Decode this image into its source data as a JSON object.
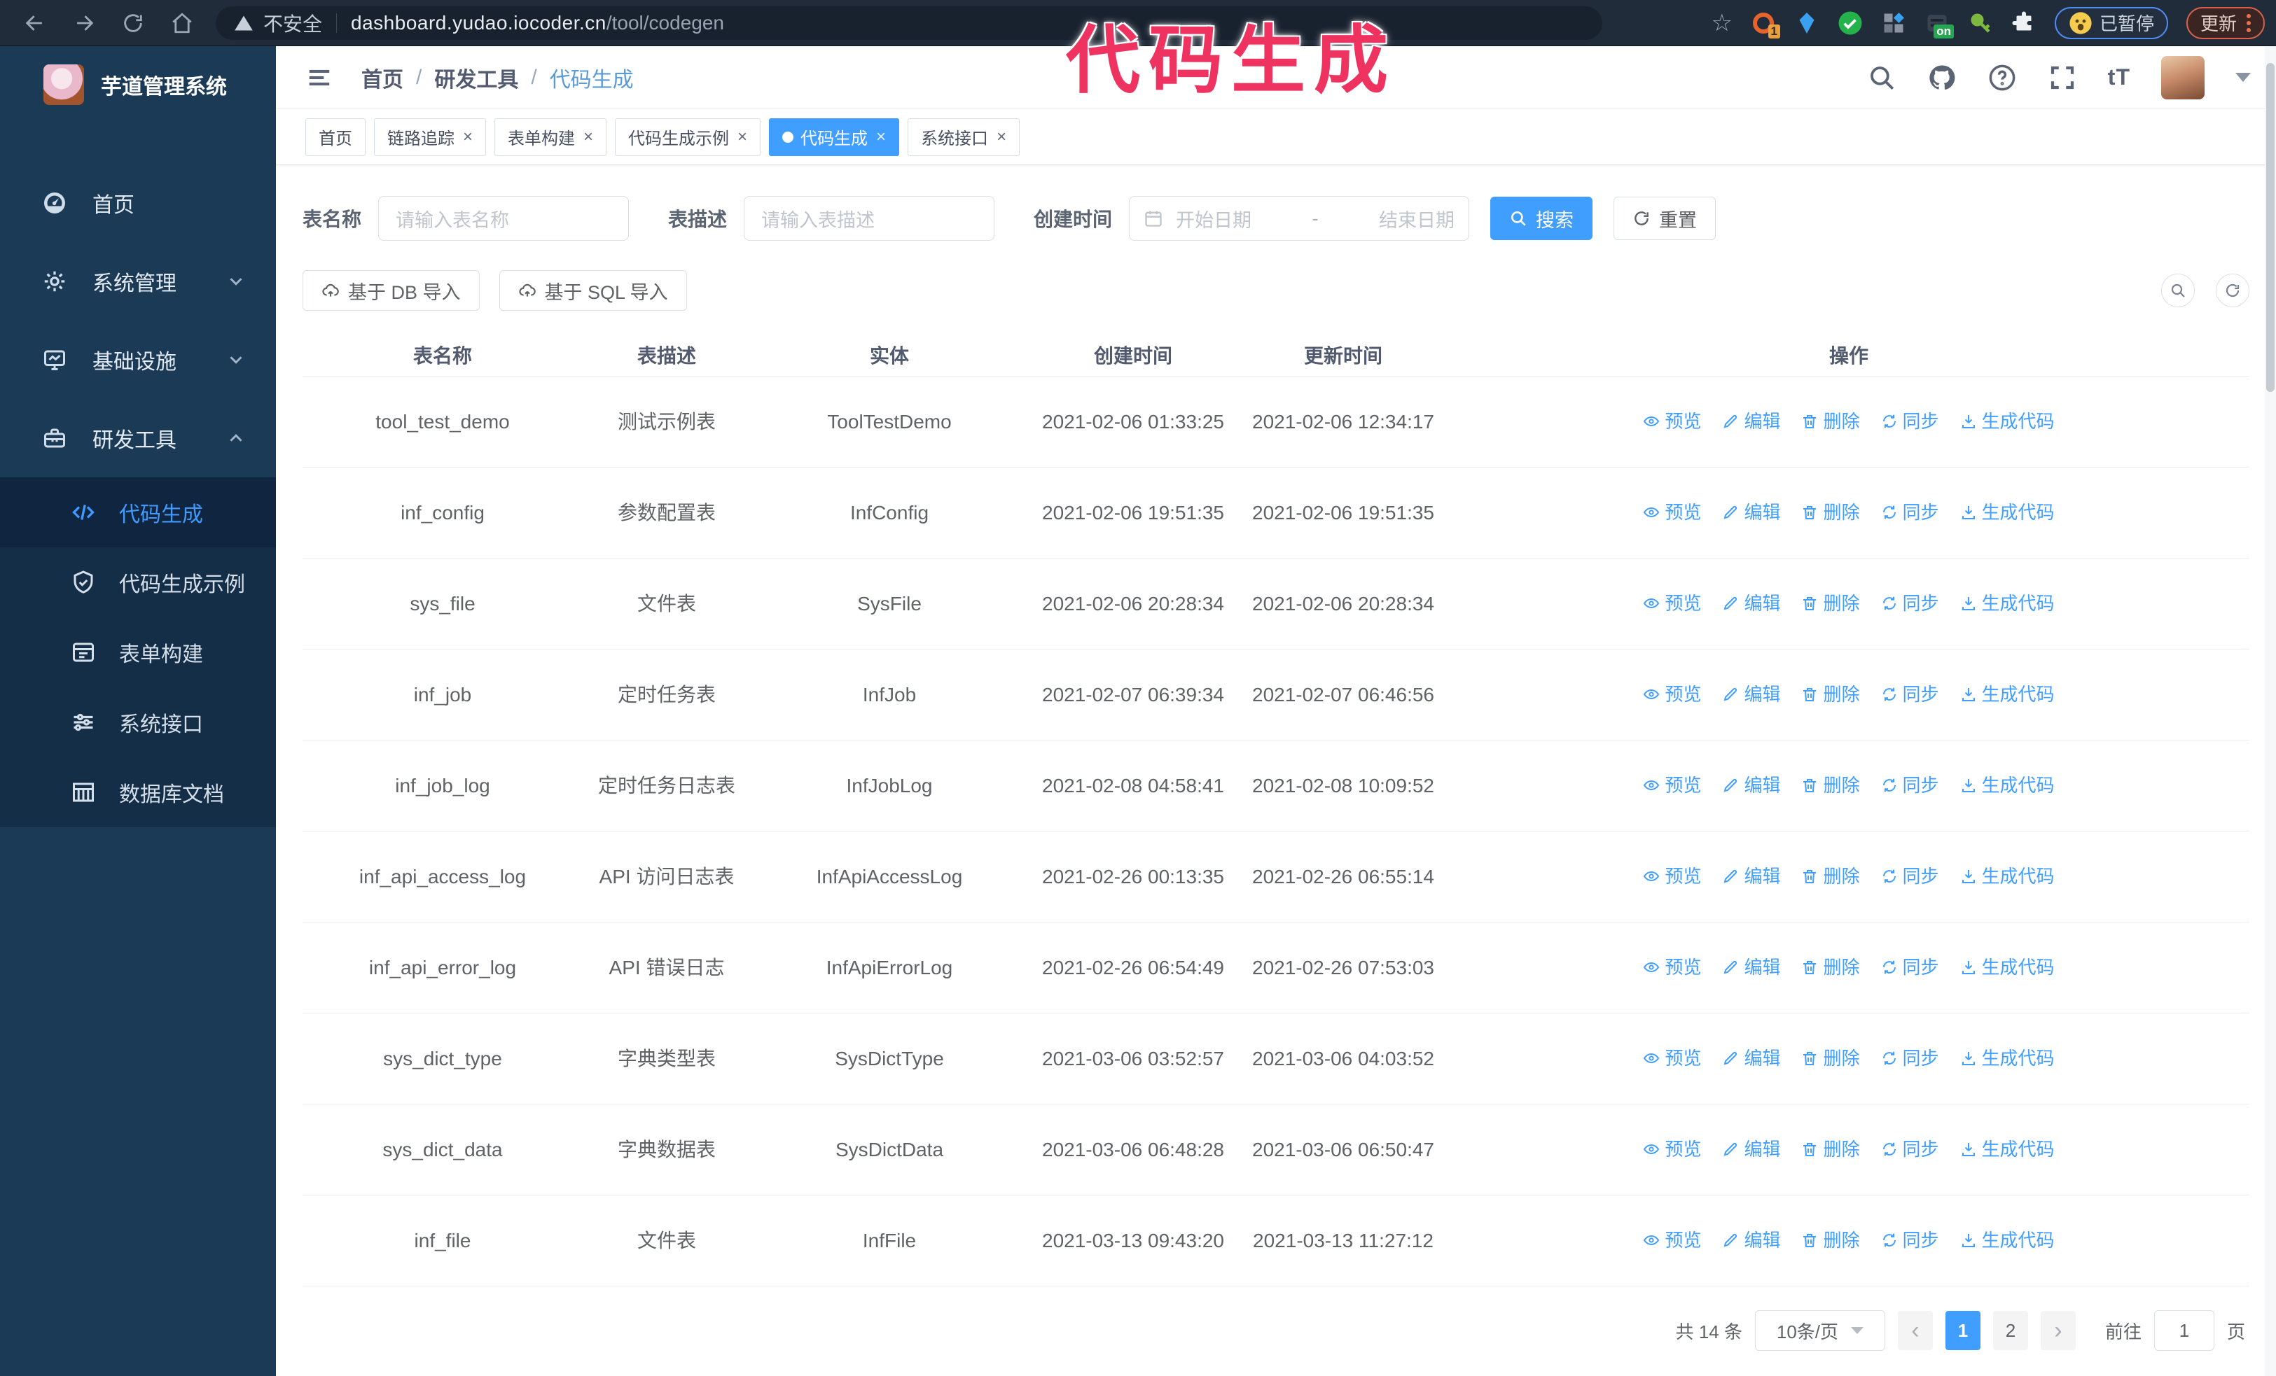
{
  "browser": {
    "security_label": "不安全",
    "url_host": "dashboard.yudao.iocoder.cn",
    "url_path": "/tool/codegen",
    "extension_badge_count": "1",
    "extension_badge_on": "on",
    "paused_badge": "已暂停",
    "update_button": "更新"
  },
  "annotation": {
    "text": "代码生成",
    "color": "#ef3360"
  },
  "sidebar": {
    "logo_title": "芋道管理系统",
    "items": [
      {
        "label": "首页",
        "icon": "dashboard-icon"
      },
      {
        "label": "系统管理",
        "icon": "gear-icon",
        "chevron": "down"
      },
      {
        "label": "基础设施",
        "icon": "monitor-icon",
        "chevron": "down"
      },
      {
        "label": "研发工具",
        "icon": "toolbox-icon",
        "chevron": "up",
        "expanded": true
      }
    ],
    "subitems": [
      {
        "label": "代码生成",
        "icon": "code-icon",
        "active": true
      },
      {
        "label": "代码生成示例",
        "icon": "shield-check-icon",
        "active": false
      },
      {
        "label": "表单构建",
        "icon": "form-icon",
        "active": false
      },
      {
        "label": "系统接口",
        "icon": "sliders-icon",
        "active": false
      },
      {
        "label": "数据库文档",
        "icon": "database-doc-icon",
        "active": false
      }
    ]
  },
  "header": {
    "breadcrumb": [
      "首页",
      "研发工具",
      "代码生成"
    ],
    "breadcrumb_separator": "/"
  },
  "tabs": [
    {
      "label": "首页",
      "closable": false,
      "active": false
    },
    {
      "label": "链路追踪",
      "closable": true,
      "active": false
    },
    {
      "label": "表单构建",
      "closable": true,
      "active": false
    },
    {
      "label": "代码生成示例",
      "closable": true,
      "active": false
    },
    {
      "label": "代码生成",
      "closable": true,
      "active": true
    },
    {
      "label": "系统接口",
      "closable": true,
      "active": false
    }
  ],
  "search_form": {
    "table_name_label": "表名称",
    "table_name_placeholder": "请输入表名称",
    "table_desc_label": "表描述",
    "table_desc_placeholder": "请输入表描述",
    "create_time_label": "创建时间",
    "date_start_placeholder": "开始日期",
    "date_separator": "-",
    "date_end_placeholder": "结束日期",
    "search_button": "搜索",
    "reset_button": "重置"
  },
  "toolbar": {
    "import_db_button": "基于 DB 导入",
    "import_sql_button": "基于 SQL 导入"
  },
  "table": {
    "columns": [
      "表名称",
      "表描述",
      "实体",
      "创建时间",
      "更新时间",
      "操作"
    ],
    "actions": [
      "预览",
      "编辑",
      "删除",
      "同步",
      "生成代码"
    ],
    "rows": [
      {
        "name": "tool_test_demo",
        "desc": "测试示例表",
        "entity": "ToolTestDemo",
        "created": "2021-02-06 01:33:25",
        "updated": "2021-02-06 12:34:17"
      },
      {
        "name": "inf_config",
        "desc": "参数配置表",
        "entity": "InfConfig",
        "created": "2021-02-06 19:51:35",
        "updated": "2021-02-06 19:51:35"
      },
      {
        "name": "sys_file",
        "desc": "文件表",
        "entity": "SysFile",
        "created": "2021-02-06 20:28:34",
        "updated": "2021-02-06 20:28:34"
      },
      {
        "name": "inf_job",
        "desc": "定时任务表",
        "entity": "InfJob",
        "created": "2021-02-07 06:39:34",
        "updated": "2021-02-07 06:46:56"
      },
      {
        "name": "inf_job_log",
        "desc": "定时任务日志表",
        "entity": "InfJobLog",
        "created": "2021-02-08 04:58:41",
        "updated": "2021-02-08 10:09:52"
      },
      {
        "name": "inf_api_access_log",
        "desc": "API 访问日志表",
        "entity": "InfApiAccessLog",
        "created": "2021-02-26 00:13:35",
        "updated": "2021-02-26 06:55:14"
      },
      {
        "name": "inf_api_error_log",
        "desc": "API 错误日志",
        "entity": "InfApiErrorLog",
        "created": "2021-02-26 06:54:49",
        "updated": "2021-02-26 07:53:03"
      },
      {
        "name": "sys_dict_type",
        "desc": "字典类型表",
        "entity": "SysDictType",
        "created": "2021-03-06 03:52:57",
        "updated": "2021-03-06 04:03:52"
      },
      {
        "name": "sys_dict_data",
        "desc": "字典数据表",
        "entity": "SysDictData",
        "created": "2021-03-06 06:48:28",
        "updated": "2021-03-06 06:50:47"
      },
      {
        "name": "inf_file",
        "desc": "文件表",
        "entity": "InfFile",
        "created": "2021-03-13 09:43:20",
        "updated": "2021-03-13 11:27:12"
      }
    ]
  },
  "pagination": {
    "total_text": "共 14 条",
    "page_size": "10条/页",
    "prev_arrow": "‹",
    "next_arrow": "›",
    "pages": [
      "1",
      "2"
    ],
    "active_page": "1",
    "goto_label": "前往",
    "goto_value": "1",
    "goto_suffix": "页"
  },
  "colors": {
    "accent": "#409eff",
    "sidebar_bg": "#1b3a56",
    "annotation": "#ef3360"
  }
}
